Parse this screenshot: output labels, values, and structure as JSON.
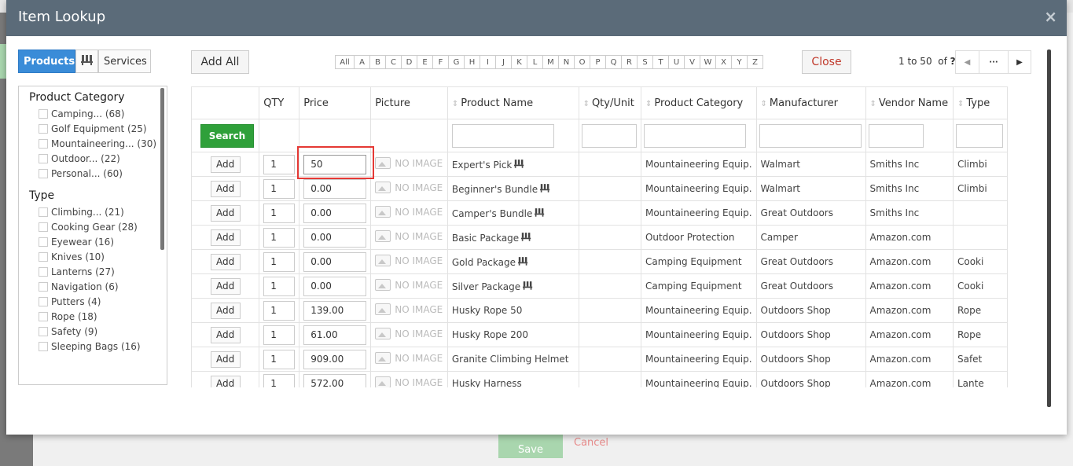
{
  "background": {
    "save_label": "Save",
    "cancel_label": "Cancel"
  },
  "modal": {
    "title": "Item Lookup",
    "close_icon": "×"
  },
  "toolbar": {
    "products_label": "Products",
    "kit_icon": "kit-icon",
    "services_label": "Services",
    "add_all_label": "Add All",
    "close_label": "Close",
    "alphabet": [
      "All",
      "A",
      "B",
      "C",
      "D",
      "E",
      "F",
      "G",
      "H",
      "I",
      "J",
      "K",
      "L",
      "M",
      "N",
      "O",
      "P",
      "Q",
      "R",
      "S",
      "T",
      "U",
      "V",
      "W",
      "X",
      "Y",
      "Z"
    ],
    "pagination": {
      "range": "1 to 50",
      "of": "of",
      "total": "?",
      "more": "···"
    }
  },
  "sidebar": {
    "category_heading": "Product Category",
    "categories": [
      {
        "label": "Camping... (68)"
      },
      {
        "label": "Golf Equipment (25)"
      },
      {
        "label": "Mountaineering... (30)"
      },
      {
        "label": "Outdoor... (22)"
      },
      {
        "label": "Personal... (60)"
      }
    ],
    "type_heading": "Type",
    "types": [
      {
        "label": "Climbing... (21)"
      },
      {
        "label": "Cooking Gear (28)"
      },
      {
        "label": "Eyewear (16)"
      },
      {
        "label": "Knives (10)"
      },
      {
        "label": "Lanterns (27)"
      },
      {
        "label": "Navigation (6)"
      },
      {
        "label": "Putters (4)"
      },
      {
        "label": "Rope (18)"
      },
      {
        "label": "Safety (9)"
      },
      {
        "label": "Sleeping Bags (16)"
      }
    ]
  },
  "grid": {
    "columns": [
      "",
      "QTY",
      "Price",
      "Picture",
      "Product Name",
      "Qty/Unit",
      "Product Category",
      "Manufacturer",
      "Vendor Name",
      "Type"
    ],
    "search_label": "Search",
    "add_label": "Add",
    "no_image_label": "NO IMAGE",
    "rows": [
      {
        "qty": "1",
        "price": "50",
        "name": "Expert's Pick",
        "kit": true,
        "qty_unit": "",
        "category": "Mountaineering Equip.",
        "manufacturer": "Walmart",
        "vendor": "Smiths Inc",
        "type": "Climbi"
      },
      {
        "qty": "1",
        "price": "0.00",
        "name": "Beginner's Bundle",
        "kit": true,
        "qty_unit": "",
        "category": "Mountaineering Equip.",
        "manufacturer": "Walmart",
        "vendor": "Smiths Inc",
        "type": "Climbi"
      },
      {
        "qty": "1",
        "price": "0.00",
        "name": "Camper's Bundle",
        "kit": true,
        "qty_unit": "",
        "category": "Mountaineering Equip.",
        "manufacturer": "Great Outdoors",
        "vendor": "Smiths Inc",
        "type": ""
      },
      {
        "qty": "1",
        "price": "0.00",
        "name": "Basic Package",
        "kit": true,
        "qty_unit": "",
        "category": "Outdoor Protection",
        "manufacturer": "Camper",
        "vendor": "Amazon.com",
        "type": ""
      },
      {
        "qty": "1",
        "price": "0.00",
        "name": "Gold Package",
        "kit": true,
        "qty_unit": "",
        "category": "Camping Equipment",
        "manufacturer": "Great Outdoors",
        "vendor": "Amazon.com",
        "type": "Cooki"
      },
      {
        "qty": "1",
        "price": "0.00",
        "name": "Silver Package",
        "kit": true,
        "qty_unit": "",
        "category": "Camping Equipment",
        "manufacturer": "Great Outdoors",
        "vendor": "Amazon.com",
        "type": "Cooki"
      },
      {
        "qty": "1",
        "price": "139.00",
        "name": "Husky Rope 50",
        "kit": false,
        "qty_unit": "",
        "category": "Mountaineering Equip.",
        "manufacturer": "Outdoors Shop",
        "vendor": "Amazon.com",
        "type": "Rope"
      },
      {
        "qty": "1",
        "price": "61.00",
        "name": "Husky Rope 200",
        "kit": false,
        "qty_unit": "",
        "category": "Mountaineering Equip.",
        "manufacturer": "Outdoors Shop",
        "vendor": "Amazon.com",
        "type": "Rope"
      },
      {
        "qty": "1",
        "price": "909.00",
        "name": "Granite Climbing Helmet",
        "kit": false,
        "qty_unit": "",
        "category": "Mountaineering Equip.",
        "manufacturer": "Outdoors Shop",
        "vendor": "Amazon.com",
        "type": "Safet"
      },
      {
        "qty": "1",
        "price": "572.00",
        "name": "Husky Harness",
        "kit": false,
        "qty_unit": "",
        "category": "Mountaineering Equip.",
        "manufacturer": "Outdoors Shop",
        "vendor": "Amazon.com",
        "type": "Lante"
      }
    ]
  },
  "colors": {
    "header": "#5b6b79",
    "accent": "#3a8cd8",
    "search": "#2fa03a",
    "close": "#c0392b",
    "highlight": "#e53935"
  }
}
